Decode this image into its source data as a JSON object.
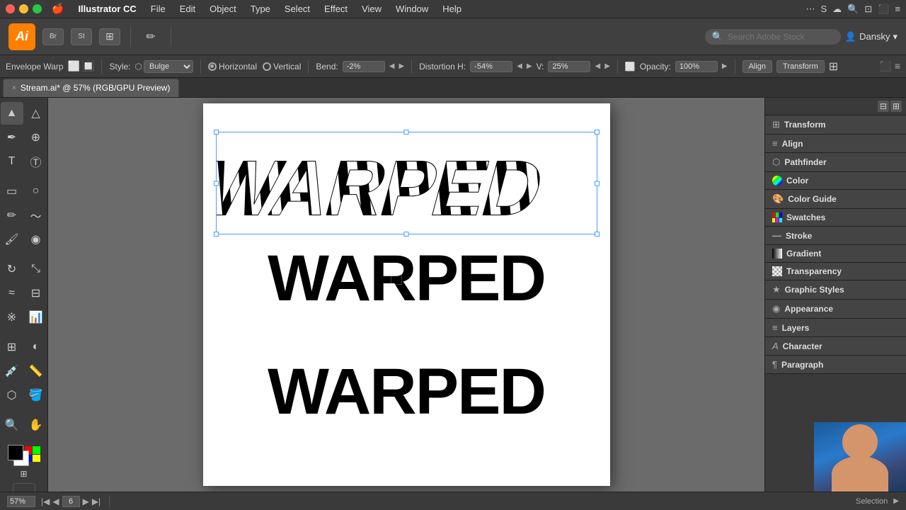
{
  "menubar": {
    "apple": "🍎",
    "app_name": "Illustrator CC",
    "menus": [
      "File",
      "Edit",
      "Object",
      "Type",
      "Select",
      "Effect",
      "View",
      "Window",
      "Help"
    ]
  },
  "toolbar": {
    "ai_logo": "Ai",
    "bridge_label": "Br",
    "stock_label": "St",
    "library_label": "☰",
    "user_name": "Dansky",
    "search_placeholder": "Search Adobe Stock"
  },
  "options_bar": {
    "tool_label": "Envelope Warp",
    "style_label": "Style:",
    "style_value": "Bulge",
    "horizontal_label": "Horizontal",
    "vertical_label": "Vertical",
    "bend_label": "Bend:",
    "bend_value": "-2%",
    "distortion_h_label": "Distortion H:",
    "distortion_h_value": "-54%",
    "distortion_v_label": "V:",
    "distortion_v_value": "25%",
    "opacity_label": "Opacity:",
    "opacity_value": "100%",
    "align_label": "Align",
    "transform_label": "Transform"
  },
  "tab": {
    "close_icon": "×",
    "title": "Stream.ai* @ 57% (RGB/GPU Preview)"
  },
  "canvas": {
    "warped_text": "WARPED",
    "normal_text_1": "WARPED",
    "normal_text_2": "WARPED"
  },
  "right_panel": {
    "items": [
      {
        "name": "Transform",
        "icon_type": "grid"
      },
      {
        "name": "Align",
        "icon_type": "align"
      },
      {
        "name": "Pathfinder",
        "icon_type": "path"
      },
      {
        "name": "Color",
        "icon_type": "circle"
      },
      {
        "name": "Color Guide",
        "icon_type": "guide"
      },
      {
        "name": "Swatches",
        "icon_type": "swatches"
      },
      {
        "name": "Stroke",
        "icon_type": "stroke"
      },
      {
        "name": "Gradient",
        "icon_type": "gradient"
      },
      {
        "name": "Transparency",
        "icon_type": "transparency"
      },
      {
        "name": "Graphic Styles",
        "icon_type": "styles"
      },
      {
        "name": "Appearance",
        "icon_type": "appearance"
      },
      {
        "name": "Layers",
        "icon_type": "layers"
      },
      {
        "name": "Character",
        "icon_type": "char"
      },
      {
        "name": "Paragraph",
        "icon_type": "para"
      }
    ]
  },
  "status_bar": {
    "zoom": "57%",
    "page": "6",
    "tool": "Selection"
  },
  "icons": {
    "transform_icon": "⊞",
    "align_icon": "≡",
    "pathfinder_icon": "⬡",
    "color_icon": "●",
    "swatches_icon": "▦",
    "stroke_icon": "—",
    "gradient_icon": "◐",
    "transparency_icon": "◻",
    "graphic_styles_icon": "★",
    "appearance_icon": "◉",
    "layers_icon": "≡",
    "character_icon": "A",
    "paragraph_icon": "¶",
    "chevron_down": "▾"
  }
}
